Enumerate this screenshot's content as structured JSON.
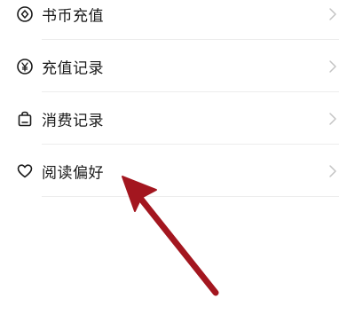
{
  "menu": {
    "items": [
      {
        "label": "书币充值",
        "icon": "coin-diamond-icon"
      },
      {
        "label": "充值记录",
        "icon": "yen-circle-icon"
      },
      {
        "label": "消费记录",
        "icon": "shopping-bag-icon"
      },
      {
        "label": "阅读偏好",
        "icon": "heart-icon"
      }
    ]
  },
  "colors": {
    "text": "#1a1a1a",
    "chevron": "#c4c4c4",
    "divider": "#ececec",
    "arrow": "#a3161f"
  }
}
